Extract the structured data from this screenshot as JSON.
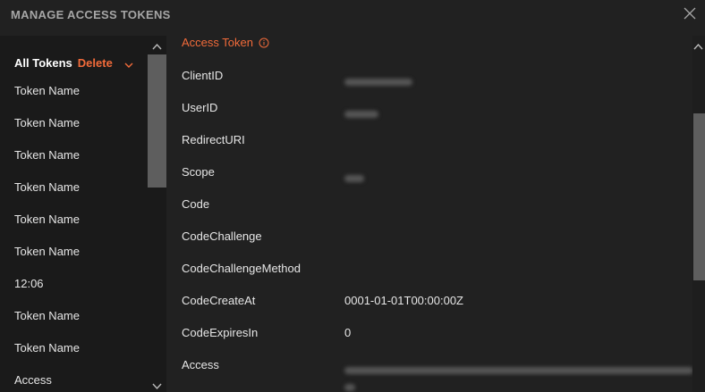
{
  "header": {
    "title": "MANAGE ACCESS TOKENS"
  },
  "sidebar": {
    "all_tokens_label": "All Tokens",
    "delete_label": "Delete",
    "items": [
      {
        "label": "Token Name"
      },
      {
        "label": "Token Name"
      },
      {
        "label": "Token Name"
      },
      {
        "label": "Token Name"
      },
      {
        "label": "Token Name"
      },
      {
        "label": "Token Name"
      },
      {
        "label": "12:06"
      },
      {
        "label": "Token Name"
      },
      {
        "label": "Token Name"
      },
      {
        "label": "Access"
      }
    ]
  },
  "main": {
    "section_title": "Access Token",
    "fields": [
      {
        "label": "ClientID",
        "value": ""
      },
      {
        "label": "UserID",
        "value": ""
      },
      {
        "label": "RedirectURI",
        "value": ""
      },
      {
        "label": "Scope",
        "value": ""
      },
      {
        "label": "Code",
        "value": ""
      },
      {
        "label": "CodeChallenge",
        "value": ""
      },
      {
        "label": "CodeChallengeMethod",
        "value": ""
      },
      {
        "label": "CodeCreateAt",
        "value": "0001-01-01T00:00:00Z"
      },
      {
        "label": "CodeExpiresIn",
        "value": "0"
      },
      {
        "label": "Access",
        "value": ""
      }
    ]
  },
  "colors": {
    "accent": "#f26b3a",
    "background": "#212121",
    "sidebar_background": "#1a1a1a",
    "scrollbar_thumb": "#5e5e5e"
  },
  "icons": {
    "close": "close-icon",
    "chevron": "chevron-down-icon",
    "info": "info-icon",
    "scroll_up": "chevron-up-icon",
    "scroll_down": "chevron-down-icon"
  }
}
